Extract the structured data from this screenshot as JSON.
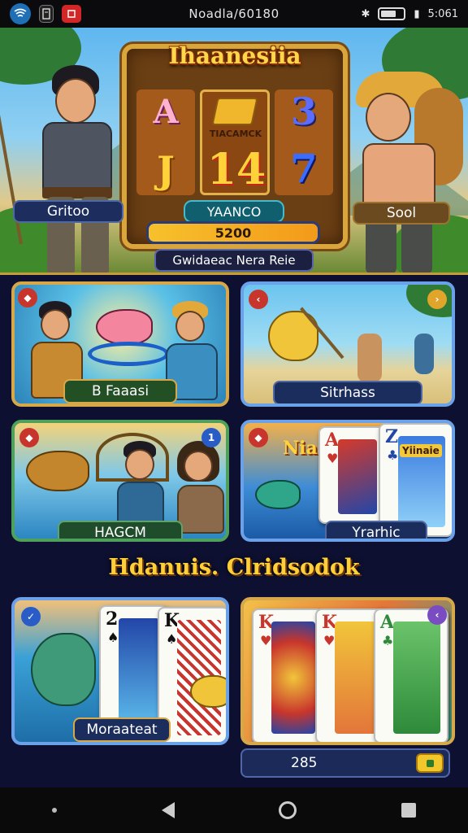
{
  "status_bar": {
    "title": "Noadla/60180",
    "time": "5:061",
    "icons": [
      "wifi-app-icon",
      "notes-icon",
      "youtube-icon",
      "bluetooth-icon",
      "battery-icon",
      "signal-icon"
    ]
  },
  "hero": {
    "slot_title": "Ihaanesiia",
    "reel_symbols": [
      "A",
      "TIACAMCK",
      "3",
      "J",
      "14",
      "7"
    ],
    "name_pill": "YAANCO",
    "coin_bar": "5200",
    "left_label": "Gritoo",
    "right_label": "Sool",
    "banner": "Gwidaeac Nera Reie"
  },
  "tiles": [
    {
      "label": "B Faaasi"
    },
    {
      "label": "Sitrhass"
    },
    {
      "label": "HAGCM"
    },
    {
      "label": "Yrarhic",
      "card_text": "Niaa",
      "card_rank": "Z",
      "card_sub": "Yiinaie"
    },
    {
      "label": "Moraateat",
      "card1": "2",
      "card2": "K"
    },
    {
      "cards": [
        "K",
        "K",
        "A"
      ]
    }
  ],
  "section_title": "Hdanuis. Clridsodok",
  "counter": "285",
  "colors": {
    "accent_gold": "#ffcf3a",
    "label_blue": "#1d2e5e",
    "tile_border": "#6ba1e8",
    "badge_red": "#c8352c",
    "badge_purple": "#7a4cc2"
  }
}
